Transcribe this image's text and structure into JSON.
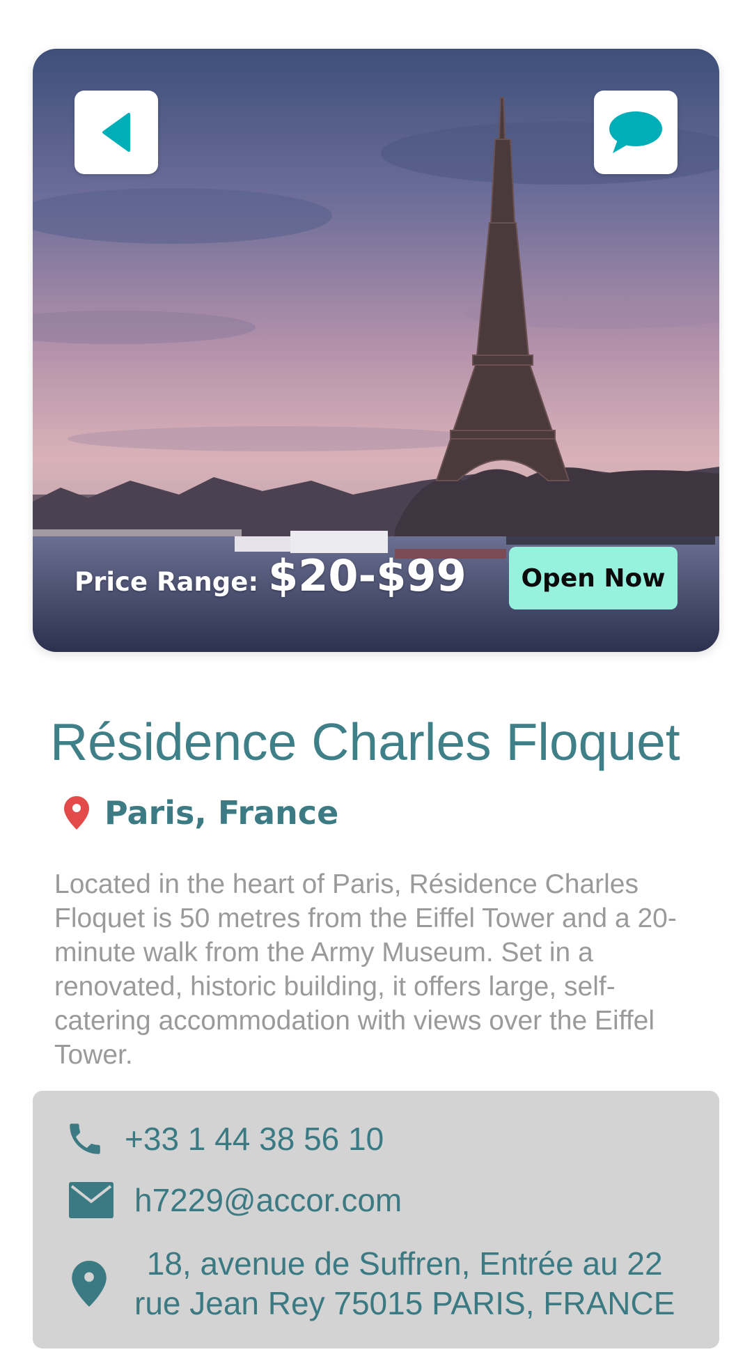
{
  "hero": {
    "price_label": "Price Range:",
    "price_value": "$20-$99",
    "open_button": "Open Now"
  },
  "title": "Résidence Charles Floquet",
  "location": "Paris, France",
  "description": "Located in the heart of Paris, Résidence Charles Floquet is 50 metres from the Eiffel Tower and a 20-minute walk from the Army Museum. Set in a renovated, historic building, it offers large, self-catering accommodation with views over the Eiffel Tower.",
  "contact": {
    "phone": "+33 1 44 38 56 10",
    "email": "h7229@accor.com",
    "address": "18, avenue de Suffren, Entrée au 22\nrue Jean Rey 75015 PARIS, FRANCE"
  },
  "icons": {
    "back": "back-arrow-icon",
    "chat": "chat-bubble-icon",
    "location": "map-pin-icon",
    "phone": "phone-icon",
    "email": "mail-icon",
    "address": "map-pin-icon"
  },
  "colors": {
    "accent": "#00aeb8",
    "title": "#3f7f88",
    "open_button": "#96f2dc",
    "pin": "#e34a4a",
    "contact_bg": "#d3d3d3"
  }
}
